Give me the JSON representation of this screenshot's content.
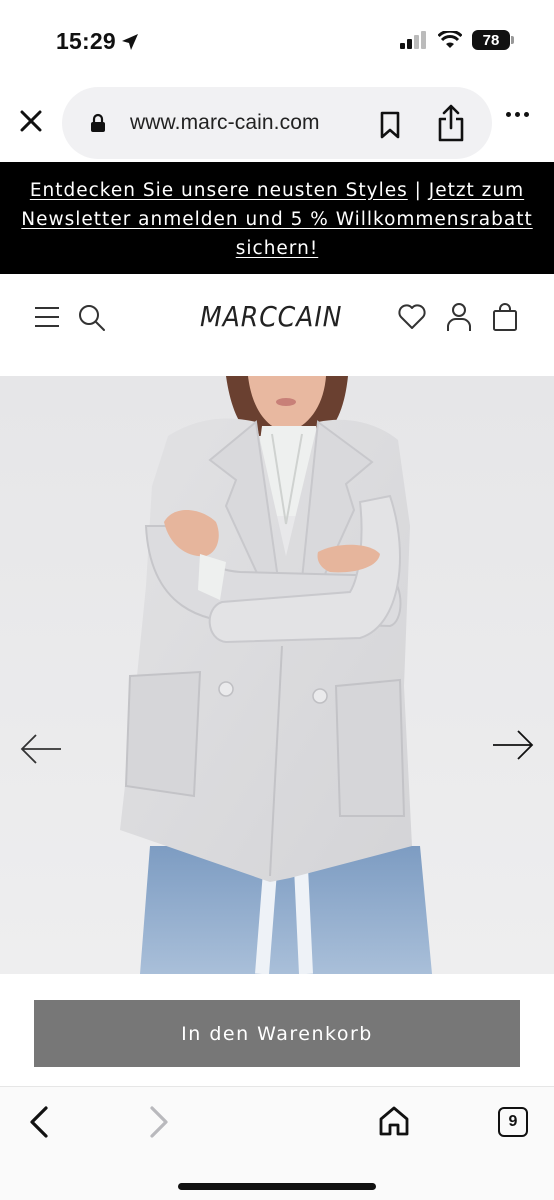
{
  "status_bar": {
    "time": "15:29",
    "battery": "78"
  },
  "browser": {
    "url": "www.marc-cain.com",
    "tab_count": "9"
  },
  "promo": {
    "part1": "Entdecken Sie unsere neusten Styles",
    "separator": " | ",
    "part2": "Jetzt zum Newsletter anmelden und 5 % Willkommensrabatt sichern!"
  },
  "header": {
    "logo": "MARCCAIN"
  },
  "product": {
    "add_to_cart_label": "In den Warenkorb"
  },
  "colors": {
    "promo_bg": "#000000",
    "cart_button_bg": "#777777",
    "gallery_bg": "#e9e9ea"
  },
  "icons": [
    "location-arrow-icon",
    "signal-icon",
    "wifi-icon",
    "battery-icon",
    "close-icon",
    "lock-icon",
    "bookmark-icon",
    "share-icon",
    "more-icon",
    "menu-icon",
    "search-icon",
    "heart-icon",
    "user-icon",
    "bag-icon",
    "arrow-left-icon",
    "arrow-right-icon",
    "chevron-left-icon",
    "chevron-right-icon",
    "home-icon",
    "tabs-icon"
  ]
}
